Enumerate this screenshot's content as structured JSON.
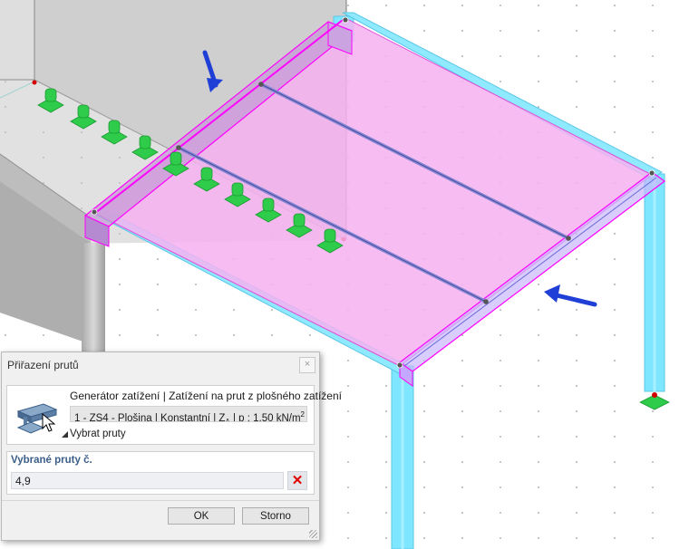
{
  "dialog": {
    "title": "Přiřazení prutů",
    "close_label": "×",
    "generator_title": "Generátor zatížení | Zatížení na prut z plošného zatížení",
    "generator_value_main": "1 - ZS4 - Plošina | Konstantní | Z",
    "generator_value_sub": "A",
    "generator_value_tail": " | p : 1.50 kN/m",
    "generator_value_sup": "2",
    "select_members_label": "Vybrat pruty",
    "selected_members_label": "Vybrané pruty č.",
    "selected_members_value": "4,9",
    "clear_label": "✕",
    "ok_label": "OK",
    "cancel_label": "Storno"
  },
  "colors": {
    "surface_fill": "#f5b0f0",
    "member_outline": "#ff00ff",
    "column": "#7fe6ff",
    "support": "#2ecc4a",
    "arrow": "#1f3fd6",
    "wall": "#d3d3d3"
  },
  "icons": [
    "beam-icon",
    "cursor-icon",
    "close-icon",
    "clear-icon",
    "arrow-icon",
    "support-icon"
  ]
}
